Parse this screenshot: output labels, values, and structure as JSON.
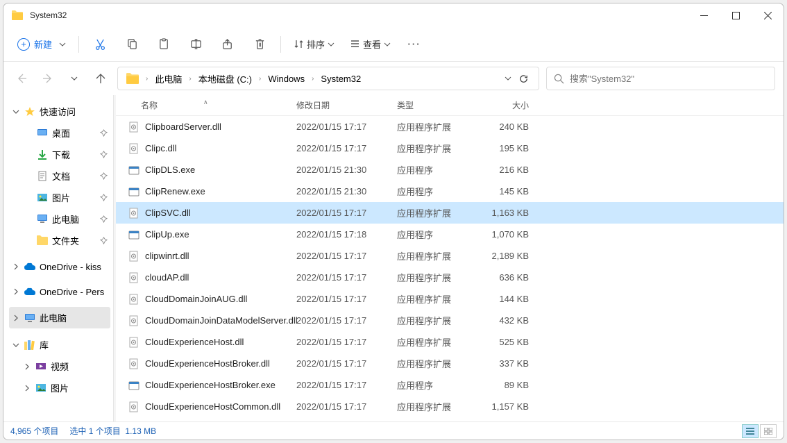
{
  "window": {
    "title": "System32"
  },
  "toolbar": {
    "new_label": "新建",
    "sort_label": "排序",
    "view_label": "查看"
  },
  "breadcrumb": {
    "items": [
      "此电脑",
      "本地磁盘 (C:)",
      "Windows",
      "System32"
    ]
  },
  "search": {
    "placeholder": "搜索\"System32\""
  },
  "sidebar": {
    "quick": {
      "label": "快速访问",
      "items": [
        {
          "label": "桌面",
          "icon": "desktop"
        },
        {
          "label": "下载",
          "icon": "download"
        },
        {
          "label": "文档",
          "icon": "doc"
        },
        {
          "label": "图片",
          "icon": "pic"
        },
        {
          "label": "此电脑",
          "icon": "pc"
        },
        {
          "label": "文件夹",
          "icon": "folder"
        }
      ]
    },
    "onedrive1": "OneDrive - kiss",
    "onedrive2": "OneDrive - Pers",
    "thispc": "此电脑",
    "library": {
      "label": "库",
      "items": [
        {
          "label": "视频",
          "icon": "video"
        },
        {
          "label": "图片",
          "icon": "pic"
        }
      ]
    }
  },
  "columns": {
    "name": "名称",
    "date": "修改日期",
    "type": "类型",
    "size": "大小"
  },
  "files": [
    {
      "name": "ClipboardServer.dll",
      "date": "2022/01/15 17:17",
      "type": "应用程序扩展",
      "size": "240 KB",
      "icon": "dll"
    },
    {
      "name": "Clipc.dll",
      "date": "2022/01/15 17:17",
      "type": "应用程序扩展",
      "size": "195 KB",
      "icon": "dll"
    },
    {
      "name": "ClipDLS.exe",
      "date": "2022/01/15 21:30",
      "type": "应用程序",
      "size": "216 KB",
      "icon": "exe"
    },
    {
      "name": "ClipRenew.exe",
      "date": "2022/01/15 21:30",
      "type": "应用程序",
      "size": "145 KB",
      "icon": "exe"
    },
    {
      "name": "ClipSVC.dll",
      "date": "2022/01/15 17:17",
      "type": "应用程序扩展",
      "size": "1,163 KB",
      "icon": "dll",
      "selected": true
    },
    {
      "name": "ClipUp.exe",
      "date": "2022/01/15 17:18",
      "type": "应用程序",
      "size": "1,070 KB",
      "icon": "exe"
    },
    {
      "name": "clipwinrt.dll",
      "date": "2022/01/15 17:17",
      "type": "应用程序扩展",
      "size": "2,189 KB",
      "icon": "dll"
    },
    {
      "name": "cloudAP.dll",
      "date": "2022/01/15 17:17",
      "type": "应用程序扩展",
      "size": "636 KB",
      "icon": "dll"
    },
    {
      "name": "CloudDomainJoinAUG.dll",
      "date": "2022/01/15 17:17",
      "type": "应用程序扩展",
      "size": "144 KB",
      "icon": "dll"
    },
    {
      "name": "CloudDomainJoinDataModelServer.dll",
      "date": "2022/01/15 17:17",
      "type": "应用程序扩展",
      "size": "432 KB",
      "icon": "dll"
    },
    {
      "name": "CloudExperienceHost.dll",
      "date": "2022/01/15 17:17",
      "type": "应用程序扩展",
      "size": "525 KB",
      "icon": "dll"
    },
    {
      "name": "CloudExperienceHostBroker.dll",
      "date": "2022/01/15 17:17",
      "type": "应用程序扩展",
      "size": "337 KB",
      "icon": "dll"
    },
    {
      "name": "CloudExperienceHostBroker.exe",
      "date": "2022/01/15 17:17",
      "type": "应用程序",
      "size": "89 KB",
      "icon": "exe"
    },
    {
      "name": "CloudExperienceHostCommon.dll",
      "date": "2022/01/15 17:17",
      "type": "应用程序扩展",
      "size": "1,157 KB",
      "icon": "dll"
    }
  ],
  "status": {
    "items": "4,965 个项目",
    "selected": "选中 1 个项目",
    "size": "1.13 MB"
  }
}
